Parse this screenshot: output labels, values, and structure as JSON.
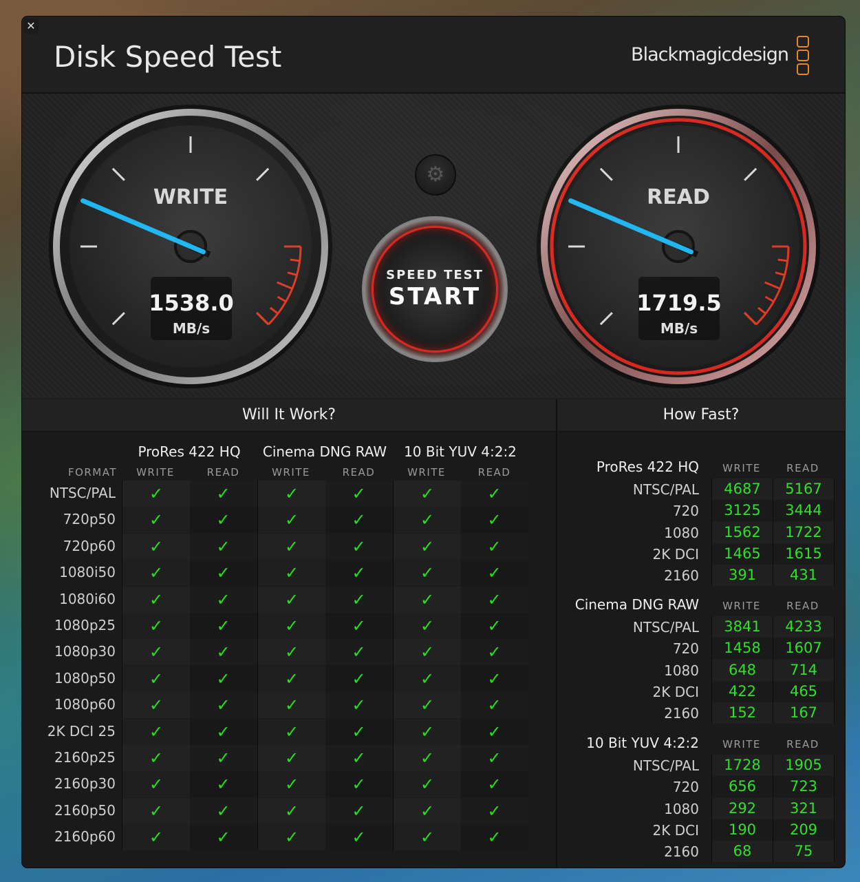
{
  "app": {
    "title": "Disk Speed Test",
    "brand": "Blackmagicdesign",
    "close_label": "✕"
  },
  "gauges": {
    "write": {
      "label": "WRITE",
      "value": "1538.0",
      "unit": "MB/s"
    },
    "read": {
      "label": "READ",
      "value": "1719.5",
      "unit": "MB/s"
    }
  },
  "start_button": {
    "line1": "SPEED TEST",
    "line2": "START"
  },
  "settings_icon": "gear-icon",
  "will_it_work": {
    "title": "Will It Work?",
    "format_header": "FORMAT",
    "groups": [
      "ProRes 422 HQ",
      "Cinema DNG RAW",
      "10 Bit YUV 4:2:2"
    ],
    "sub_headers": [
      "WRITE",
      "READ"
    ],
    "formats": [
      "NTSC/PAL",
      "720p50",
      "720p60",
      "1080i50",
      "1080i60",
      "1080p25",
      "1080p30",
      "1080p50",
      "1080p60",
      "2K DCI 25",
      "2160p25",
      "2160p30",
      "2160p50",
      "2160p60"
    ],
    "check_symbol": "✓"
  },
  "how_fast": {
    "title": "How Fast?",
    "sub_headers": [
      "WRITE",
      "READ"
    ],
    "groups": [
      {
        "name": "ProRes 422 HQ",
        "rows": [
          {
            "label": "NTSC/PAL",
            "write": "4687",
            "read": "5167"
          },
          {
            "label": "720",
            "write": "3125",
            "read": "3444"
          },
          {
            "label": "1080",
            "write": "1562",
            "read": "1722"
          },
          {
            "label": "2K DCI",
            "write": "1465",
            "read": "1615"
          },
          {
            "label": "2160",
            "write": "391",
            "read": "431"
          }
        ]
      },
      {
        "name": "Cinema DNG RAW",
        "rows": [
          {
            "label": "NTSC/PAL",
            "write": "3841",
            "read": "4233"
          },
          {
            "label": "720",
            "write": "1458",
            "read": "1607"
          },
          {
            "label": "1080",
            "write": "648",
            "read": "714"
          },
          {
            "label": "2K DCI",
            "write": "422",
            "read": "465"
          },
          {
            "label": "2160",
            "write": "152",
            "read": "167"
          }
        ]
      },
      {
        "name": "10 Bit YUV 4:2:2",
        "rows": [
          {
            "label": "NTSC/PAL",
            "write": "1728",
            "read": "1905"
          },
          {
            "label": "720",
            "write": "656",
            "read": "723"
          },
          {
            "label": "1080",
            "write": "292",
            "read": "321"
          },
          {
            "label": "2K DCI",
            "write": "190",
            "read": "209"
          },
          {
            "label": "2160",
            "write": "68",
            "read": "75"
          }
        ]
      }
    ]
  },
  "colors": {
    "accent_green": "#27e01e",
    "needle_blue": "#1fb6f0",
    "alert_red": "#d8281f",
    "brand_orange": "#e28a2b"
  }
}
